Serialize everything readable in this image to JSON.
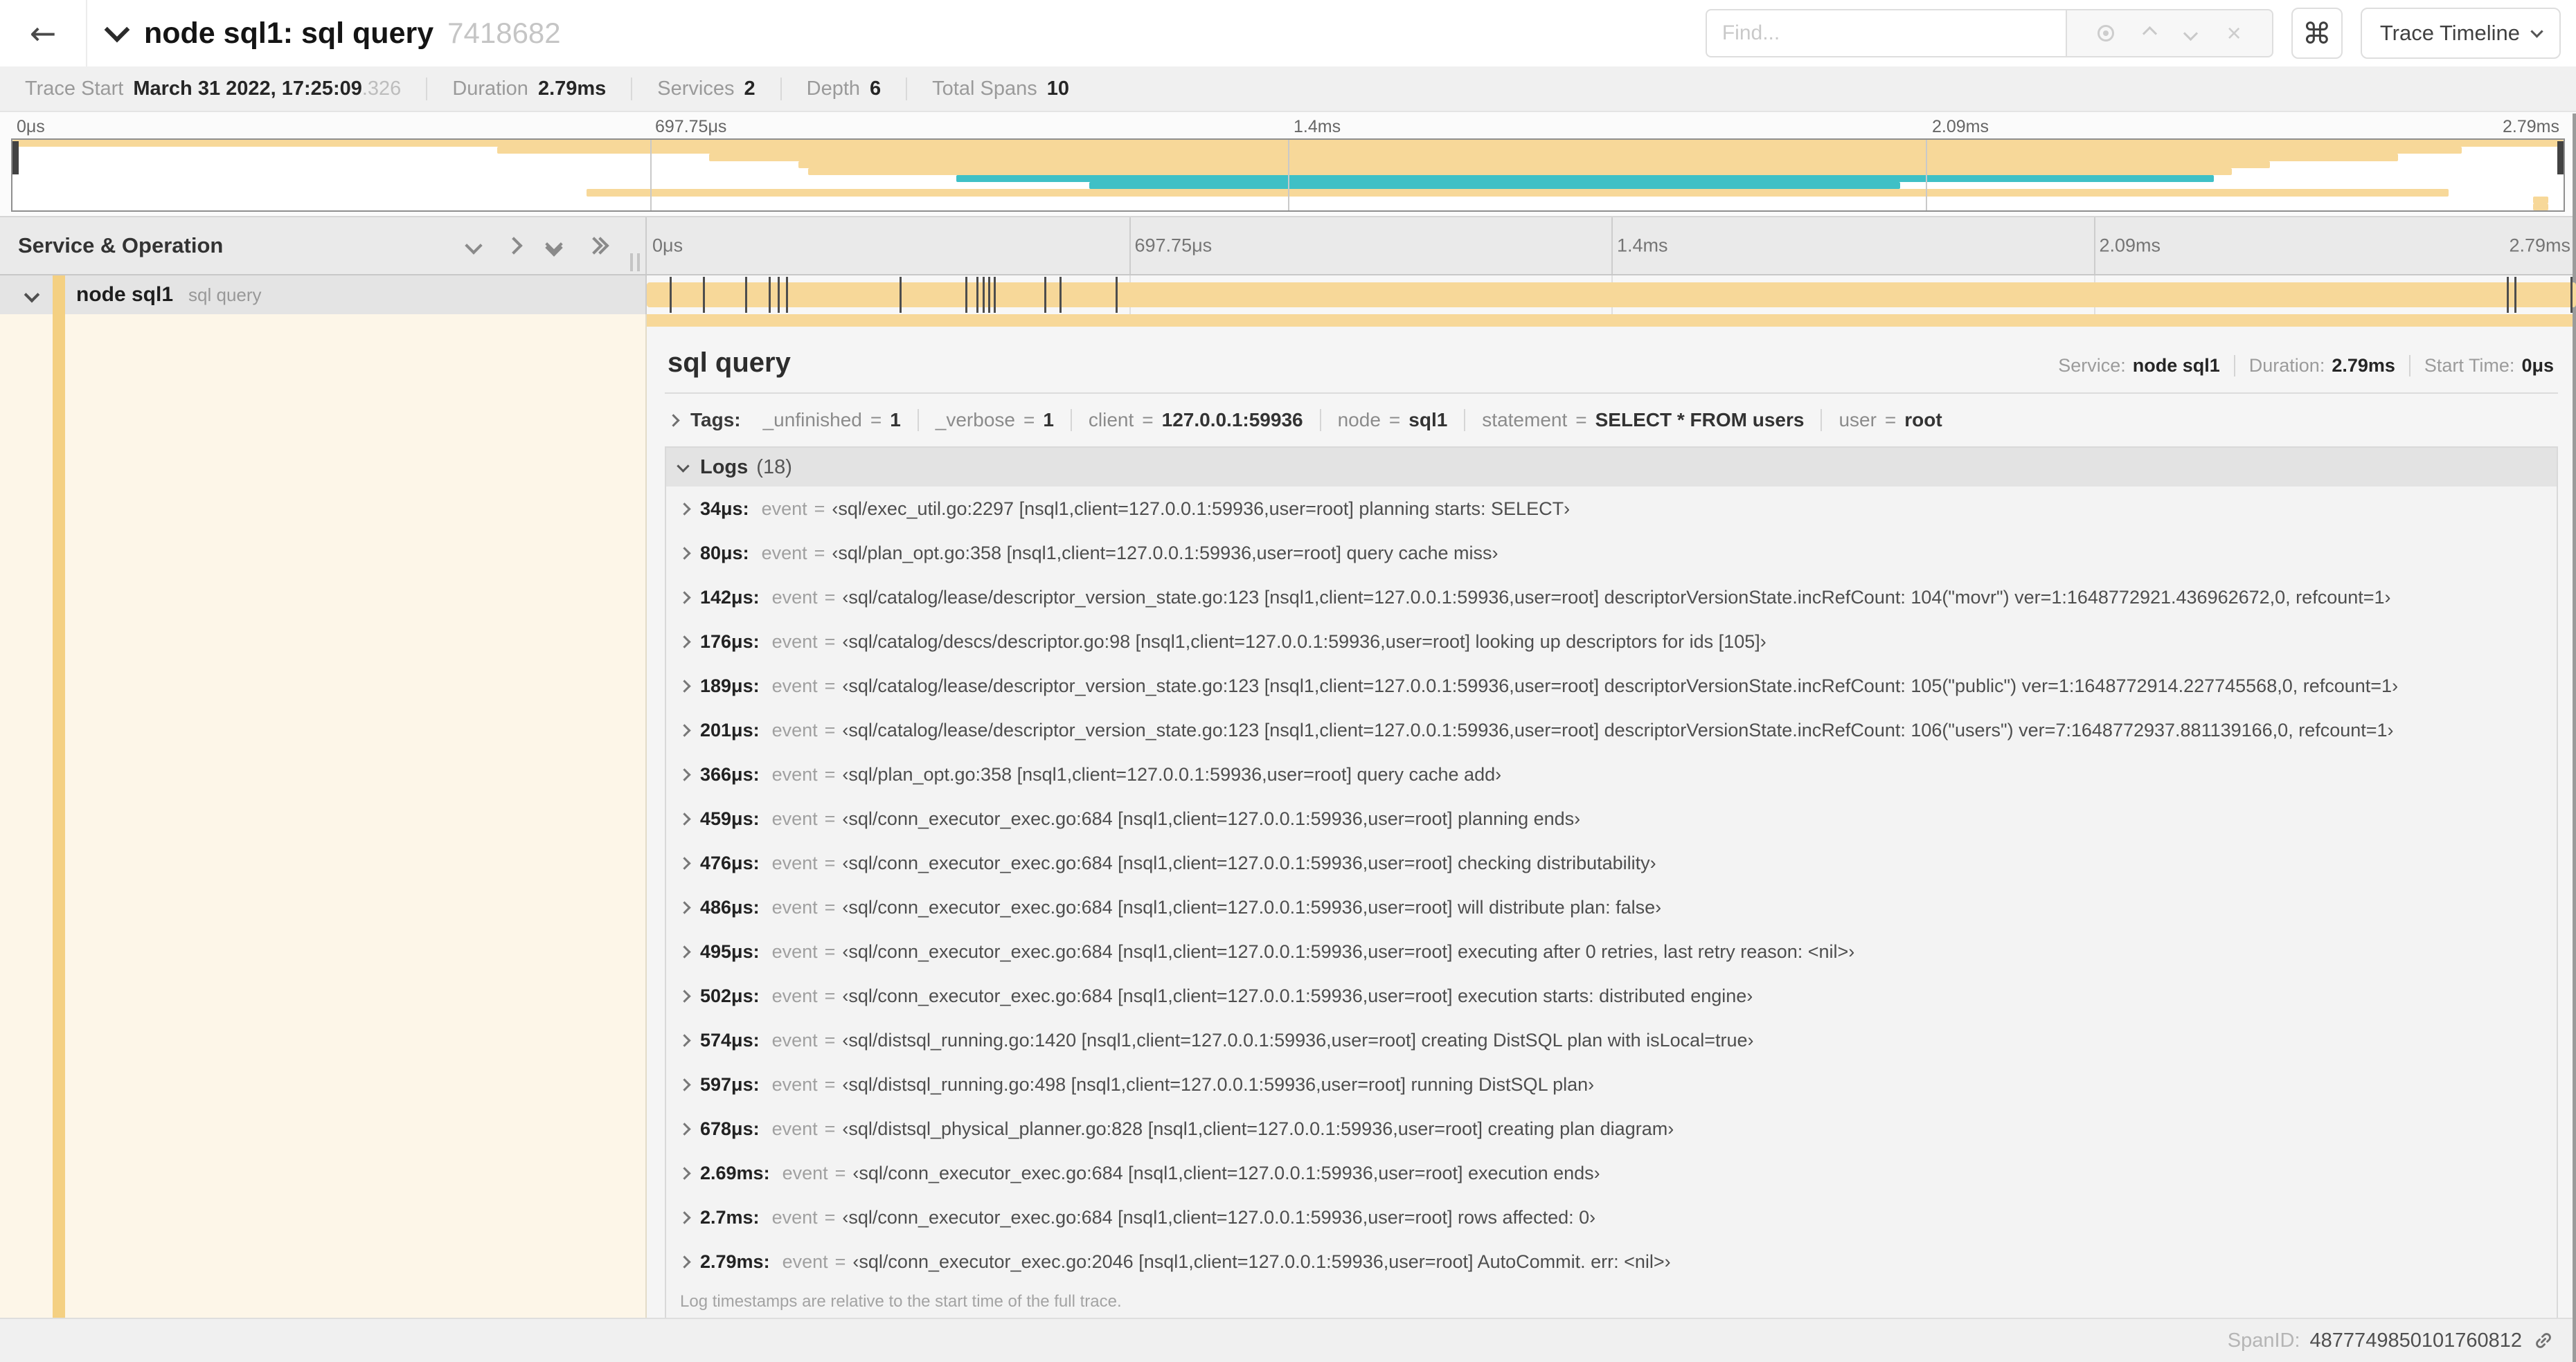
{
  "colors": {
    "span_tan": "#F7D899",
    "span_teal": "#3FC0C6",
    "accent_tan": "#F4D082",
    "detail_bg": "#FDF6E8"
  },
  "header": {
    "back_icon": "←",
    "title": "node sql1: sql query",
    "trace_id": "7418682",
    "find": {
      "placeholder": "Find...",
      "clear_icon": "×"
    },
    "command_icon": "⌘",
    "view_button": {
      "label": "Trace Timeline"
    }
  },
  "stats": {
    "items": [
      {
        "label": "Trace Start",
        "value": "March 31 2022, 17:25:09",
        "suffix": ".326"
      },
      {
        "label": "Duration",
        "value": "2.79ms"
      },
      {
        "label": "Services",
        "value": "2"
      },
      {
        "label": "Depth",
        "value": "6"
      },
      {
        "label": "Total Spans",
        "value": "10"
      }
    ]
  },
  "timeline": {
    "ticks": [
      {
        "label": "0μs",
        "pct": 0
      },
      {
        "label": "697.75μs",
        "pct": 25
      },
      {
        "label": "1.4ms",
        "pct": 50
      },
      {
        "label": "2.09ms",
        "pct": 75
      },
      {
        "label": "2.79ms",
        "pct": 100
      }
    ],
    "minimap_spans": [
      {
        "s": 0,
        "e": 100,
        "c": "span_tan"
      },
      {
        "s": 19,
        "e": 96,
        "c": "span_tan"
      },
      {
        "s": 27.3,
        "e": 93.5,
        "c": "span_tan"
      },
      {
        "s": 30.8,
        "e": 88.5,
        "c": "span_tan"
      },
      {
        "s": 31.2,
        "e": 87,
        "c": "span_tan"
      },
      {
        "s": 37,
        "e": 86.3,
        "c": "span_teal"
      },
      {
        "s": 42.2,
        "e": 74,
        "c": "span_teal"
      },
      {
        "s": 22.5,
        "e": 95.5,
        "c": "span_tan"
      },
      {
        "s": 98.8,
        "e": 99.4,
        "c": "span_tan"
      },
      {
        "s": 98.8,
        "e": 99.4,
        "c": "span_tan"
      }
    ]
  },
  "span_table": {
    "header": "Service & Operation",
    "row": {
      "service": "node sql1",
      "operation": "sql query"
    },
    "bar": {
      "start": 0,
      "end": 100,
      "color": "span_tan"
    }
  },
  "detail": {
    "operation": "sql query",
    "summary": [
      {
        "label": "Service:",
        "value": "node sql1"
      },
      {
        "label": "Duration:",
        "value": "2.79ms"
      },
      {
        "label": "Start Time:",
        "value": "0μs"
      }
    ],
    "tags": {
      "label": "Tags:",
      "items": [
        {
          "key": "_unfinished",
          "value": "1"
        },
        {
          "key": "_verbose",
          "value": "1"
        },
        {
          "key": "client",
          "value": "127.0.0.1:59936"
        },
        {
          "key": "node",
          "value": "sql1"
        },
        {
          "key": "statement",
          "value": "SELECT * FROM users"
        },
        {
          "key": "user",
          "value": "root"
        }
      ]
    },
    "logs": {
      "title": "Logs",
      "count": "(18)",
      "key": "event",
      "rows": [
        {
          "time": "34μs:",
          "pct": 1.2,
          "value": "‹sql/exec_util.go:2297 [nsql1,client=127.0.0.1:59936,user=root] planning starts: SELECT›"
        },
        {
          "time": "80μs:",
          "pct": 2.9,
          "value": "‹sql/plan_opt.go:358 [nsql1,client=127.0.0.1:59936,user=root] query cache miss›"
        },
        {
          "time": "142μs:",
          "pct": 5.1,
          "value": "‹sql/catalog/lease/descriptor_version_state.go:123 [nsql1,client=127.0.0.1:59936,user=root] descriptorVersionState.incRefCount: 104(\"movr\") ver=1:1648772921.436962672,0, refcount=1›"
        },
        {
          "time": "176μs:",
          "pct": 6.3,
          "value": "‹sql/catalog/descs/descriptor.go:98 [nsql1,client=127.0.0.1:59936,user=root] looking up descriptors for ids [105]›"
        },
        {
          "time": "189μs:",
          "pct": 6.8,
          "value": "‹sql/catalog/lease/descriptor_version_state.go:123 [nsql1,client=127.0.0.1:59936,user=root] descriptorVersionState.incRefCount: 105(\"public\") ver=1:1648772914.227745568,0, refcount=1›"
        },
        {
          "time": "201μs:",
          "pct": 7.2,
          "value": "‹sql/catalog/lease/descriptor_version_state.go:123 [nsql1,client=127.0.0.1:59936,user=root] descriptorVersionState.incRefCount: 106(\"users\") ver=7:1648772937.881139166,0, refcount=1›"
        },
        {
          "time": "366μs:",
          "pct": 13.1,
          "value": "‹sql/plan_opt.go:358 [nsql1,client=127.0.0.1:59936,user=root] query cache add›"
        },
        {
          "time": "459μs:",
          "pct": 16.5,
          "value": "‹sql/conn_executor_exec.go:684 [nsql1,client=127.0.0.1:59936,user=root] planning ends›"
        },
        {
          "time": "476μs:",
          "pct": 17.1,
          "value": "‹sql/conn_executor_exec.go:684 [nsql1,client=127.0.0.1:59936,user=root] checking distributability›"
        },
        {
          "time": "486μs:",
          "pct": 17.4,
          "value": "‹sql/conn_executor_exec.go:684 [nsql1,client=127.0.0.1:59936,user=root] will distribute plan: false›"
        },
        {
          "time": "495μs:",
          "pct": 17.7,
          "value": "‹sql/conn_executor_exec.go:684 [nsql1,client=127.0.0.1:59936,user=root] executing after 0 retries, last retry reason: <nil>›"
        },
        {
          "time": "502μs:",
          "pct": 18,
          "value": "‹sql/conn_executor_exec.go:684 [nsql1,client=127.0.0.1:59936,user=root] execution starts: distributed engine›"
        },
        {
          "time": "574μs:",
          "pct": 20.6,
          "value": "‹sql/distsql_running.go:1420 [nsql1,client=127.0.0.1:59936,user=root] creating DistSQL plan with isLocal=true›"
        },
        {
          "time": "597μs:",
          "pct": 21.4,
          "value": "‹sql/distsql_running.go:498 [nsql1,client=127.0.0.1:59936,user=root] running DistSQL plan›"
        },
        {
          "time": "678μs:",
          "pct": 24.3,
          "value": "‹sql/distsql_physical_planner.go:828 [nsql1,client=127.0.0.1:59936,user=root] creating plan diagram›"
        },
        {
          "time": "2.69ms:",
          "pct": 96.4,
          "value": "‹sql/conn_executor_exec.go:684 [nsql1,client=127.0.0.1:59936,user=root] execution ends›"
        },
        {
          "time": "2.7ms:",
          "pct": 96.8,
          "value": "‹sql/conn_executor_exec.go:684 [nsql1,client=127.0.0.1:59936,user=root] rows affected: 0›"
        },
        {
          "time": "2.79ms:",
          "pct": 99.7,
          "value": "‹sql/conn_executor_exec.go:2046 [nsql1,client=127.0.0.1:59936,user=root] AutoCommit. err: <nil>›"
        }
      ],
      "footnote": "Log timestamps are relative to the start time of the full trace."
    },
    "footer": {
      "label": "SpanID:",
      "value": "4877749850101760812"
    }
  }
}
